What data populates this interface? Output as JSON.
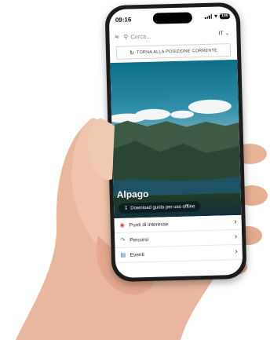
{
  "status_bar": {
    "time": "09:16",
    "battery": "100"
  },
  "search": {
    "placeholder": "Cerca...",
    "language": "IT"
  },
  "position_button": {
    "label": "TORNA ALLA POSIZIONE CORRENTE"
  },
  "hero": {
    "title": "Alpago",
    "download_label": "Download guida per uso offline"
  },
  "menu": [
    {
      "label": "Punti di interesse",
      "icon": "eye-icon",
      "color": "#d23a3a"
    },
    {
      "label": "Percorsi",
      "icon": "route-icon",
      "color": "#2e8b57"
    },
    {
      "label": "Eventi",
      "icon": "calendar-icon",
      "color": "#1e6fa8"
    }
  ]
}
